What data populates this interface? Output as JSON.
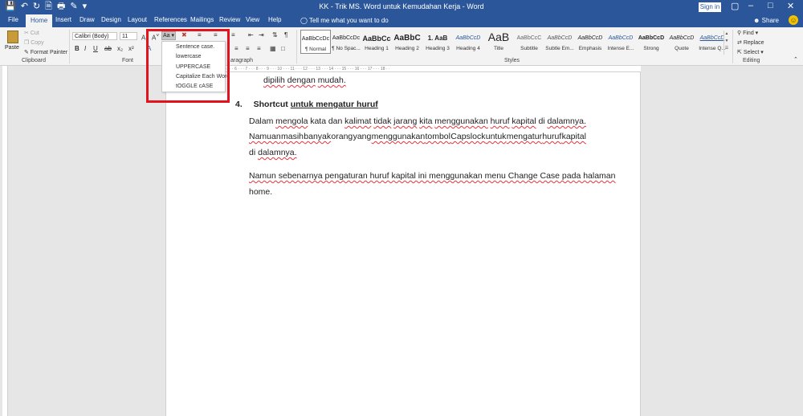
{
  "titlebar": {
    "title": "KK - Trik MS. Word untuk Kemudahan Kerja  -  Word",
    "signin": "Sign in",
    "qat_icons": [
      "save-icon",
      "undo-icon",
      "redo-icon",
      "new-icon",
      "print-preview-icon",
      "draw-icon",
      "customize-icon"
    ],
    "controls": [
      "ribbon-display-icon",
      "minimize-icon",
      "maximize-icon",
      "close-icon"
    ]
  },
  "tabs": [
    "File",
    "Home",
    "Insert",
    "Draw",
    "Design",
    "Layout",
    "References",
    "Mailings",
    "Review",
    "View",
    "Help"
  ],
  "active_tab": "Home",
  "tellme": "Tell me what you want to do",
  "share": "Share",
  "clipboard": {
    "paste": "Paste",
    "cut": "Cut",
    "copy": "Copy",
    "format_painter": "Format Painter",
    "label": "Clipboard"
  },
  "font": {
    "name": "Calibri (Body)",
    "size": "11",
    "label": "Font",
    "change_case_button": "Aa"
  },
  "paragraph": {
    "label": "Paragraph",
    "label_visible": "aragraph"
  },
  "styles": {
    "label": "Styles",
    "items": [
      {
        "sample": "AaBbCcDc",
        "name": "¶ Normal",
        "selected": true
      },
      {
        "sample": "AaBbCcDc",
        "name": "¶ No Spac..."
      },
      {
        "sample": "AaBbCc",
        "name": "Heading 1"
      },
      {
        "sample": "AaBbC",
        "name": "Heading 2"
      },
      {
        "sample": "1. AaB",
        "name": "Heading 3"
      },
      {
        "sample": "AaBbCcD",
        "name": "Heading 4"
      },
      {
        "sample": "AaB",
        "name": "Title"
      },
      {
        "sample": "AaBbCcC",
        "name": "Subtitle"
      },
      {
        "sample": "AaBbCcD",
        "name": "Subtle Em..."
      },
      {
        "sample": "AaBbCcD",
        "name": "Emphasis"
      },
      {
        "sample": "AaBbCcD",
        "name": "Intense E..."
      },
      {
        "sample": "AaBbCcD",
        "name": "Strong"
      },
      {
        "sample": "AaBbCcD",
        "name": "Quote"
      },
      {
        "sample": "AaBbCcD",
        "name": "Intense Q..."
      }
    ]
  },
  "editing": {
    "label": "Editing",
    "find": "Find",
    "replace": "Replace",
    "select": "Select"
  },
  "change_case_menu": [
    "Sentence case.",
    "lowercase",
    "UPPERCASE",
    "Capitalize Each Word",
    "tOGGLE cASE"
  ],
  "document": {
    "line_top_words": [
      "dipilih",
      "dengan",
      "mudah."
    ],
    "heading_number": "4.",
    "heading_word_1": "Shortcut",
    "heading_rest": "untuk mengatur huruf",
    "para1_line1": [
      "Dalam",
      "mengola",
      "kata",
      "dan",
      "kalimat",
      "tidak",
      "jarang",
      "kita",
      "menggunakan",
      "huruf",
      "kapital",
      "di",
      "dalamnya."
    ],
    "para1_line2": [
      "Namuan",
      "masih",
      "banyak",
      "orang",
      "yang",
      "menggunakan",
      "tombol",
      "Capslock",
      "untuk",
      "mengatur",
      "huruf",
      "kapital"
    ],
    "para1_line3": [
      "di",
      "dalamnya."
    ],
    "para2_line1": "Namun sebenarnya pengaturan huruf kapital ini menggunakan menu Change Case pada halaman",
    "para2_line2": "home."
  },
  "colors": {
    "titlebar": "#2b579a",
    "ribbon": "#f3f3f3",
    "highlight": "#e3131d",
    "squiggle": "#e8323e"
  }
}
